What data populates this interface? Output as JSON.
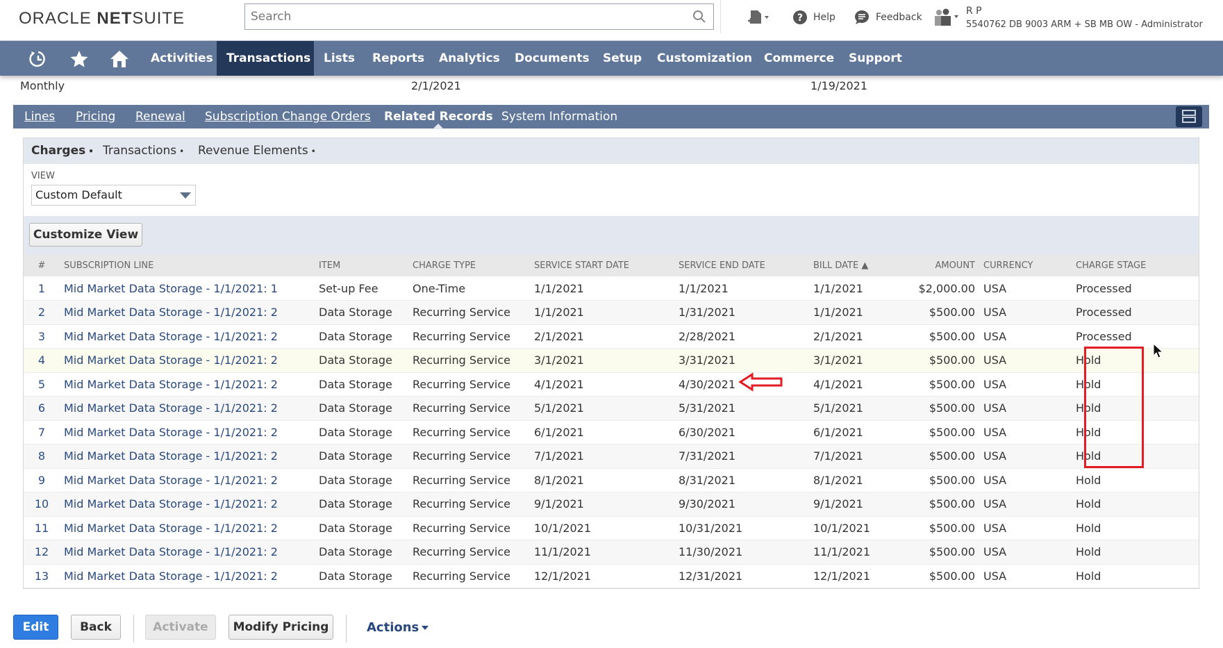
{
  "header": {
    "logo_oracle": "ORACLE",
    "logo_net": "NET",
    "logo_suite": "SUITE",
    "search_placeholder": "Search",
    "help_label": "Help",
    "feedback_label": "Feedback",
    "user_name": "R P",
    "user_role": "5540762 DB 9003 ARM + SB MB OW - Administrator"
  },
  "nav": {
    "items": [
      {
        "label": "Activities"
      },
      {
        "label": "Transactions",
        "active": true
      },
      {
        "label": "Lists"
      },
      {
        "label": "Reports"
      },
      {
        "label": "Analytics"
      },
      {
        "label": "Documents"
      },
      {
        "label": "Setup"
      },
      {
        "label": "Customization"
      },
      {
        "label": "Commerce"
      },
      {
        "label": "Support"
      }
    ]
  },
  "summary": {
    "frequency": "Monthly",
    "date1": "2/1/2021",
    "date2": "1/19/2021"
  },
  "subtabs": {
    "items": [
      {
        "label": "Lines"
      },
      {
        "label": "Pricing"
      },
      {
        "label": "Renewal"
      },
      {
        "label": "Subscription Change Orders"
      },
      {
        "label": "Related Records",
        "active": true
      },
      {
        "label": "System Information"
      }
    ]
  },
  "related": {
    "tabs": [
      {
        "label": "Charges",
        "active": true
      },
      {
        "label": "Transactions"
      },
      {
        "label": "Revenue Elements"
      }
    ],
    "tab_dot": "•",
    "view_label": "VIEW",
    "view_value": "Custom Default",
    "customize_view_label": "Customize View"
  },
  "table": {
    "columns": [
      "#",
      "SUBSCRIPTION LINE",
      "ITEM",
      "CHARGE TYPE",
      "SERVICE START DATE",
      "SERVICE END DATE",
      "BILL DATE ▲",
      "AMOUNT",
      "CURRENCY",
      "CHARGE STAGE"
    ],
    "rows": [
      {
        "n": "1",
        "line": "Mid Market Data Storage - 1/1/2021: 1",
        "item": "Set-up Fee",
        "type": "One-Time",
        "start": "1/1/2021",
        "end": "1/1/2021",
        "bill": "1/1/2021",
        "amount": "$2,000.00",
        "currency": "USA",
        "stage": "Processed"
      },
      {
        "n": "2",
        "line": "Mid Market Data Storage - 1/1/2021: 2",
        "item": "Data Storage",
        "type": "Recurring Service",
        "start": "1/1/2021",
        "end": "1/31/2021",
        "bill": "1/1/2021",
        "amount": "$500.00",
        "currency": "USA",
        "stage": "Processed"
      },
      {
        "n": "3",
        "line": "Mid Market Data Storage - 1/1/2021: 2",
        "item": "Data Storage",
        "type": "Recurring Service",
        "start": "2/1/2021",
        "end": "2/28/2021",
        "bill": "2/1/2021",
        "amount": "$500.00",
        "currency": "USA",
        "stage": "Processed"
      },
      {
        "n": "4",
        "line": "Mid Market Data Storage - 1/1/2021: 2",
        "item": "Data Storage",
        "type": "Recurring Service",
        "start": "3/1/2021",
        "end": "3/31/2021",
        "bill": "3/1/2021",
        "amount": "$500.00",
        "currency": "USA",
        "stage": "Hold"
      },
      {
        "n": "5",
        "line": "Mid Market Data Storage - 1/1/2021: 2",
        "item": "Data Storage",
        "type": "Recurring Service",
        "start": "4/1/2021",
        "end": "4/30/2021",
        "bill": "4/1/2021",
        "amount": "$500.00",
        "currency": "USA",
        "stage": "Hold"
      },
      {
        "n": "6",
        "line": "Mid Market Data Storage - 1/1/2021: 2",
        "item": "Data Storage",
        "type": "Recurring Service",
        "start": "5/1/2021",
        "end": "5/31/2021",
        "bill": "5/1/2021",
        "amount": "$500.00",
        "currency": "USA",
        "stage": "Hold"
      },
      {
        "n": "7",
        "line": "Mid Market Data Storage - 1/1/2021: 2",
        "item": "Data Storage",
        "type": "Recurring Service",
        "start": "6/1/2021",
        "end": "6/30/2021",
        "bill": "6/1/2021",
        "amount": "$500.00",
        "currency": "USA",
        "stage": "Hold"
      },
      {
        "n": "8",
        "line": "Mid Market Data Storage - 1/1/2021: 2",
        "item": "Data Storage",
        "type": "Recurring Service",
        "start": "7/1/2021",
        "end": "7/31/2021",
        "bill": "7/1/2021",
        "amount": "$500.00",
        "currency": "USA",
        "stage": "Hold"
      },
      {
        "n": "9",
        "line": "Mid Market Data Storage - 1/1/2021: 2",
        "item": "Data Storage",
        "type": "Recurring Service",
        "start": "8/1/2021",
        "end": "8/31/2021",
        "bill": "8/1/2021",
        "amount": "$500.00",
        "currency": "USA",
        "stage": "Hold"
      },
      {
        "n": "10",
        "line": "Mid Market Data Storage - 1/1/2021: 2",
        "item": "Data Storage",
        "type": "Recurring Service",
        "start": "9/1/2021",
        "end": "9/30/2021",
        "bill": "9/1/2021",
        "amount": "$500.00",
        "currency": "USA",
        "stage": "Hold"
      },
      {
        "n": "11",
        "line": "Mid Market Data Storage - 1/1/2021: 2",
        "item": "Data Storage",
        "type": "Recurring Service",
        "start": "10/1/2021",
        "end": "10/31/2021",
        "bill": "10/1/2021",
        "amount": "$500.00",
        "currency": "USA",
        "stage": "Hold"
      },
      {
        "n": "12",
        "line": "Mid Market Data Storage - 1/1/2021: 2",
        "item": "Data Storage",
        "type": "Recurring Service",
        "start": "11/1/2021",
        "end": "11/30/2021",
        "bill": "11/1/2021",
        "amount": "$500.00",
        "currency": "USA",
        "stage": "Hold"
      },
      {
        "n": "13",
        "line": "Mid Market Data Storage - 1/1/2021: 2",
        "item": "Data Storage",
        "type": "Recurring Service",
        "start": "12/1/2021",
        "end": "12/31/2021",
        "bill": "12/1/2021",
        "amount": "$500.00",
        "currency": "USA",
        "stage": "Hold"
      }
    ]
  },
  "buttons": {
    "edit": "Edit",
    "back": "Back",
    "activate": "Activate",
    "modify_pricing": "Modify Pricing",
    "actions": "Actions"
  },
  "colors": {
    "nav_bg": "#607799",
    "nav_active": "#24395a",
    "link": "#29487d",
    "primary_button": "#2f7de1",
    "annotation_red": "#e31b23"
  }
}
